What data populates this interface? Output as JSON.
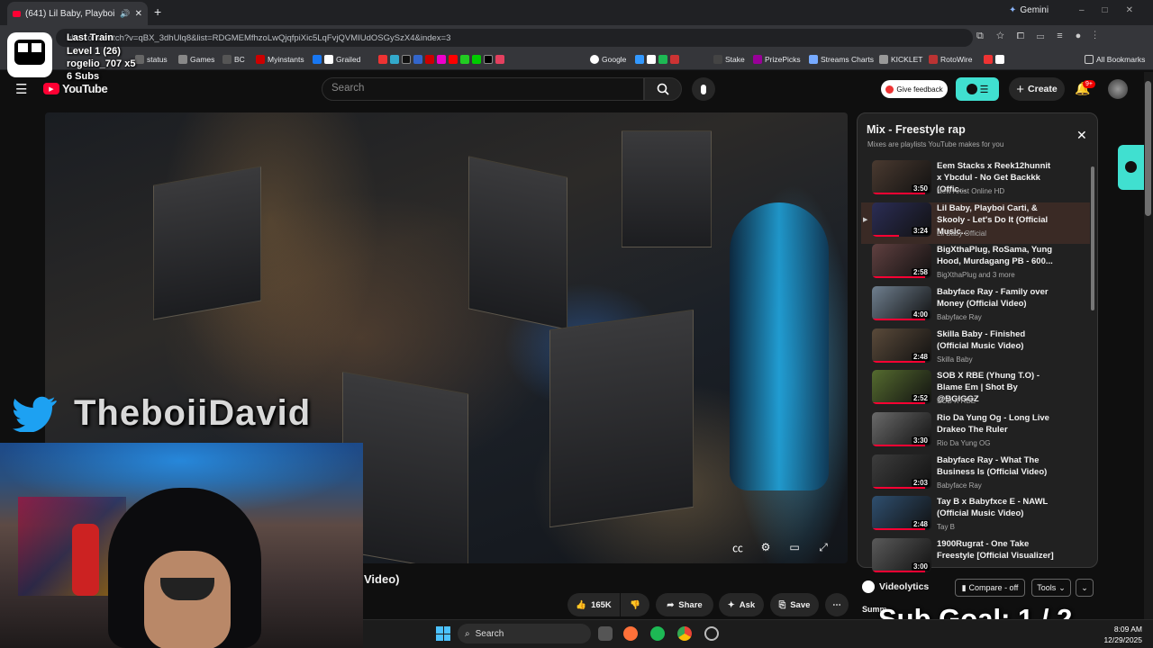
{
  "browser": {
    "tab_title": "(641) Lil Baby, Playboi Carti",
    "gemini_label": "Gemini",
    "url": "ube.com/watch?v=qBX_3dhUlq8&list=RDGMEMfhzoLwQjqfpiXic5LqFvjQVMIUdOSGySzX4&index=3",
    "bookmarks": [
      "status",
      "Games",
      "BC",
      "Myinstants",
      "Grailed",
      "Google",
      "Stake",
      "PrizePicks",
      "Streams Charts",
      "KICKLET",
      "RotoWire"
    ],
    "all_bookmarks": "All Bookmarks"
  },
  "stream": {
    "train_title": "Last Train",
    "train_level": "Level 1  (26)",
    "train_user": "rogelio_707 x5",
    "train_subs": "6 Subs",
    "twitter_handle": "TheboiiDavid",
    "sub_goal": "Sub Goal:  1 / 2"
  },
  "youtube": {
    "logo": "YouTube",
    "search_placeholder": "Search",
    "feedback": "Give feedback",
    "create": "Create",
    "notif_count": "9+"
  },
  "video": {
    "title_fragment": "Video)",
    "likes": "165K",
    "share": "Share",
    "ask": "Ask",
    "save": "Save"
  },
  "playlist": {
    "title": "Mix - Freestyle rap",
    "subtitle": "Mixes are playlists YouTube makes for you",
    "items": [
      {
        "title": "Eem Stacks x Reek12hunnit x Ybcdul - No Get Backkk (Offic...",
        "channel": "New Artist Online HD",
        "duration": "3:50",
        "progress": 0.9
      },
      {
        "title": "Lil Baby, Playboi Carti, & Skooly - Let's Do It (Official Music...",
        "channel": "Lil Baby Official",
        "duration": "3:24",
        "progress": 0.45
      },
      {
        "title": "BigXthaPlug, RoSama, Yung Hood, Murdagang PB - 600...",
        "channel": "BigXthaPlug and 3 more",
        "duration": "2:58",
        "progress": 0.9
      },
      {
        "title": "Babyface Ray - Family over Money (Official Video)",
        "channel": "Babyface Ray",
        "duration": "4:00",
        "progress": 0.9
      },
      {
        "title": "Skilla Baby - Finished (Official Music Video)",
        "channel": "Skilla Baby",
        "duration": "2:48",
        "progress": 0.9
      },
      {
        "title": "SOB X RBE (Yhung T.O) - Blame Em | Shot By @BGIGGZ",
        "channel": "SOB X RBE",
        "duration": "2:52",
        "progress": 0.9
      },
      {
        "title": "Rio Da Yung Og - Long Live Drakeo The Ruler",
        "channel": "Rio Da Yung OG",
        "duration": "3:30",
        "progress": 0.9
      },
      {
        "title": "Babyface Ray - What The Business Is (Official Video)",
        "channel": "Babyface Ray",
        "duration": "2:03",
        "progress": 0.9
      },
      {
        "title": "Tay B x Babyfxce E - NAWL (Official Music Video)",
        "channel": "Tay B",
        "duration": "2:48",
        "progress": 0.9
      },
      {
        "title": "1900Rugrat - One Take Freestyle [Official Visualizer]",
        "channel": "",
        "duration": "3:00",
        "progress": 0.9
      }
    ]
  },
  "videolytics": {
    "label": "Videolytics",
    "compare": "Compare - off",
    "tools": "Tools",
    "summary": "Summ"
  },
  "taskbar": {
    "search": "Search",
    "time": "8:09 AM",
    "date": "12/29/2025"
  },
  "colors": {
    "accent": "#ff0033",
    "teal": "#40e0d0"
  }
}
